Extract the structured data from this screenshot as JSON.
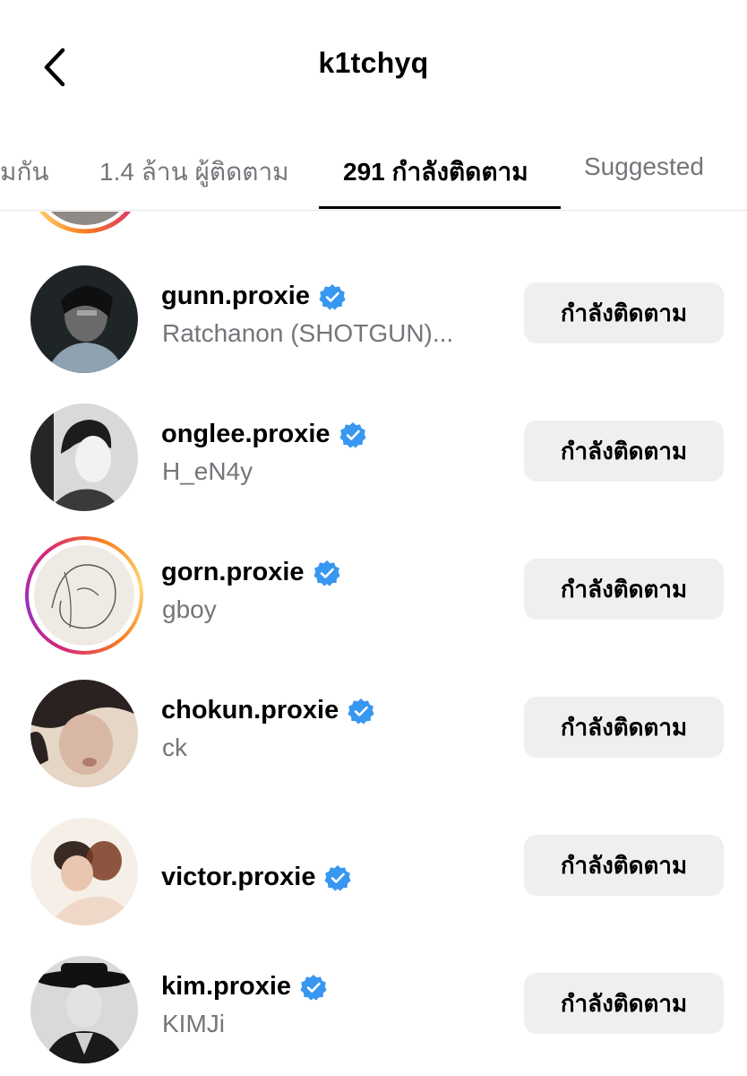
{
  "header": {
    "title": "k1tchyq",
    "back_icon": "chevron-left-icon"
  },
  "tabs": [
    {
      "label": "มกัน",
      "active": false
    },
    {
      "label": "1.4 ล้าน ผู้ติดตาม",
      "active": false
    },
    {
      "label": "291 กำลังติดตาม",
      "active": true
    },
    {
      "label": "Suggested",
      "active": false
    }
  ],
  "colors": {
    "verified_blue": "#3897f0",
    "button_bg": "#efeff1",
    "secondary_text": "#73767a"
  },
  "accounts": [
    {
      "username": "gunn.proxie",
      "subtitle": "Ratchanon (SHOTGUN)...",
      "verified": true,
      "story_ring": false,
      "button_label": "กำลังติดตาม"
    },
    {
      "username": "onglee.proxie",
      "subtitle": "H_eN4y",
      "verified": true,
      "story_ring": false,
      "button_label": "กำลังติดตาม"
    },
    {
      "username": "gorn.proxie",
      "subtitle": "gboy",
      "verified": true,
      "story_ring": true,
      "button_label": "กำลังติดตาม"
    },
    {
      "username": "chokun.proxie",
      "subtitle": "ck",
      "verified": true,
      "story_ring": false,
      "button_label": "กำลังติดตาม"
    },
    {
      "username": "victor.proxie",
      "subtitle": "",
      "verified": true,
      "story_ring": false,
      "button_label": "กำลังติดตาม"
    },
    {
      "username": "kim.proxie",
      "subtitle": "KIMJi",
      "verified": true,
      "story_ring": false,
      "button_label": "กำลังติดตาม"
    }
  ]
}
